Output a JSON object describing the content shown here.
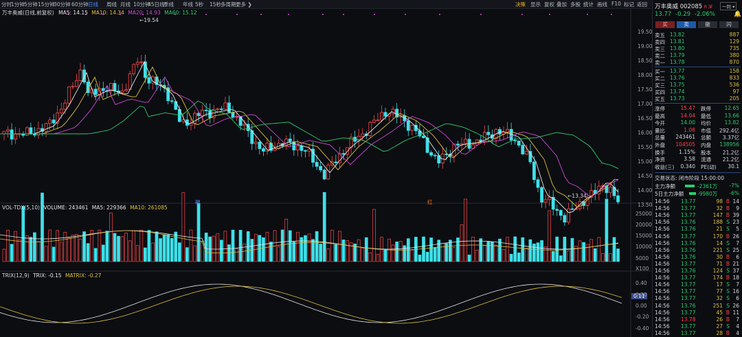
{
  "toolbar": {
    "periods": [
      "分时",
      "1分钟",
      "5分钟",
      "15分钟",
      "30分钟",
      "60分钟",
      "日线",
      "周线",
      "月线",
      "10分钟",
      "45日线",
      "季线",
      "年线",
      "5秒",
      "15秒",
      "多周期",
      "更多 ❯"
    ],
    "active_period": "日线",
    "right_items": [
      "决策",
      "显示",
      "复权",
      "叠加",
      "多股",
      "统计",
      "画线",
      "F10",
      "标记",
      "返回"
    ]
  },
  "kline": {
    "header_name": "万丰奥威(日线,前复权)",
    "ma5": "MA5: 14.15",
    "ma10": "MA10: 14.34",
    "ma20": "MA20: 14.93",
    "ma60": "MA60: 15.12",
    "high_label": "19.54",
    "low_label": "13.34",
    "y_ticks": [
      "19.50",
      "19.00",
      "18.50",
      "18.00",
      "17.50",
      "17.00",
      "16.50",
      "16.00",
      "15.50",
      "15.00",
      "14.50",
      "14.00",
      "13.50"
    ],
    "markers": [
      "融",
      "红"
    ]
  },
  "volume": {
    "header_name": "VOL-TDX(5,10)",
    "volume": "VOLUME: 243461",
    "ma5": "MA5: 229366",
    "ma10": "MA10: 261085",
    "y_ticks": [
      "25000",
      "20000",
      "15000",
      "10000",
      "5000",
      "X100"
    ]
  },
  "trix": {
    "header_name": "TRIX(12,9)",
    "trix": "TRIX: -0.15",
    "matrix": "MATRIX: -0.27",
    "y_ticks": [
      "0.40",
      "0.20",
      "0.00",
      "-0.20",
      "-0.40"
    ],
    "badge": "0.11"
  },
  "panel": {
    "name": "万丰奥威",
    "code": "002085",
    "tag": "R 深",
    "group_btn": "一同 ▾",
    "price": "13.77",
    "change": "-0.29",
    "change_pct": "-2.06%",
    "buttons": [
      "买",
      "卖",
      "撤",
      "闪"
    ],
    "asks": [
      {
        "label": "卖五",
        "price": "13.82",
        "vol": "887"
      },
      {
        "label": "卖四",
        "price": "13.81",
        "vol": "129"
      },
      {
        "label": "卖三",
        "price": "13.80",
        "vol": "735"
      },
      {
        "label": "卖二",
        "price": "13.79",
        "vol": "380"
      },
      {
        "label": "卖一",
        "price": "13.78",
        "vol": "870"
      }
    ],
    "bids": [
      {
        "label": "买一",
        "price": "13.77",
        "vol": "158"
      },
      {
        "label": "买二",
        "price": "13.76",
        "vol": "833"
      },
      {
        "label": "买三",
        "price": "13.75",
        "vol": "536"
      },
      {
        "label": "买四",
        "price": "13.74",
        "vol": "97"
      },
      {
        "label": "买五",
        "price": "13.73",
        "vol": "205"
      }
    ],
    "stats": [
      {
        "k1": "涨停",
        "v1": "15.47",
        "k2": "跌停",
        "v2": "12.65"
      },
      {
        "k1": "最高",
        "v1": "14.04",
        "k2": "最低",
        "v2": "13.66"
      },
      {
        "k1": "今开",
        "v1": "14.00",
        "k2": "均价",
        "v2": "13.82"
      },
      {
        "k1": "量比",
        "v1": "1.08",
        "k2": "市值",
        "v2": "292.4亿"
      },
      {
        "k1": "总量",
        "v1": "243461",
        "k2": "总额",
        "v2": "3.37亿"
      },
      {
        "k1": "外盘",
        "v1": "104505",
        "k2": "内盘",
        "v2": "138956"
      },
      {
        "k1": "换手",
        "v1": "1.15%",
        "k2": "股本",
        "v2": "21.2亿"
      },
      {
        "k1": "净资",
        "v1": "3.58",
        "k2": "流通",
        "v2": "21.2亿"
      },
      {
        "k1": "收益(三)",
        "v1": "0.340",
        "k2": "PE(动)",
        "v2": "30.1"
      }
    ],
    "trade_status": "交易状态: 闭市阶段 15:00:00",
    "flow1": {
      "label": "主力净额",
      "value": "-2361万",
      "pct": "-7%"
    },
    "flow2": {
      "label": "5日主力净额",
      "value": "-9980万",
      "pct": "-6%"
    },
    "ticks": [
      {
        "t": "14:56",
        "p": "13.77",
        "v": "98",
        "d": "B",
        "n": "14"
      },
      {
        "t": "14:56",
        "p": "13.77",
        "v": "32",
        "d": "B",
        "n": "9"
      },
      {
        "t": "14:56",
        "p": "13.77",
        "v": "147",
        "d": "B",
        "n": "39"
      },
      {
        "t": "14:56",
        "p": "13.76",
        "v": "188",
        "d": "S",
        "n": "23"
      },
      {
        "t": "14:56",
        "p": "13.76",
        "v": "21",
        "d": "S",
        "n": "5"
      },
      {
        "t": "14:56",
        "p": "13.77",
        "v": "170",
        "d": "B",
        "n": "26"
      },
      {
        "t": "14:56",
        "p": "13.76",
        "v": "14",
        "d": "S",
        "n": "7"
      },
      {
        "t": "14:56",
        "p": "13.76",
        "v": "221",
        "d": "S",
        "n": "25"
      },
      {
        "t": "14:56",
        "p": "13.76",
        "v": "30",
        "d": "B",
        "n": "6"
      },
      {
        "t": "14:56",
        "p": "13.77",
        "v": "71",
        "d": "B",
        "n": "21"
      },
      {
        "t": "14:56",
        "p": "13.76",
        "v": "124",
        "d": "S",
        "n": "37"
      },
      {
        "t": "14:56",
        "p": "13.77",
        "v": "174",
        "d": "B",
        "n": "18"
      },
      {
        "t": "14:56",
        "p": "13.77",
        "v": "17",
        "d": "S",
        "n": "7"
      },
      {
        "t": "14:56",
        "p": "13.77",
        "v": "77",
        "d": "S",
        "n": "16"
      },
      {
        "t": "14:56",
        "p": "13.77",
        "v": "32",
        "d": "S",
        "n": "6"
      },
      {
        "t": "14:56",
        "p": "13.76",
        "v": "251",
        "d": "S",
        "n": "26"
      },
      {
        "t": "14:56",
        "p": "13.77",
        "v": "45",
        "d": "B",
        "n": "11"
      },
      {
        "t": "14:56",
        "p": "13.78",
        "v": "26",
        "d": "B",
        "n": "7"
      },
      {
        "t": "14:56",
        "p": "13.77",
        "v": "27",
        "d": "S",
        "n": "4"
      },
      {
        "t": "14:56",
        "p": "13.77",
        "v": "28",
        "d": "B",
        "n": "4"
      }
    ]
  }
}
